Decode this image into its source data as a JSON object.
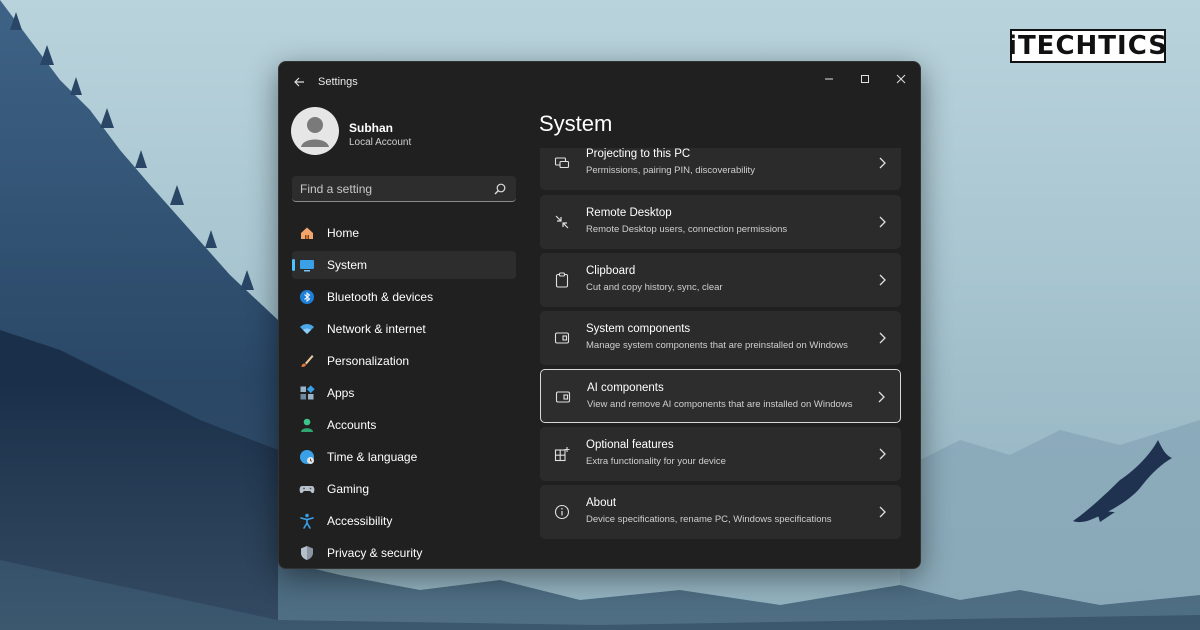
{
  "brand": {
    "logo_text": "iTECHTICS"
  },
  "window": {
    "title": "Settings",
    "controls": [
      "minimize-icon",
      "maximize-icon",
      "close-icon"
    ]
  },
  "user": {
    "name": "Subhan",
    "account_type": "Local Account"
  },
  "search": {
    "placeholder": "Find a setting",
    "value": ""
  },
  "sidebar": {
    "items": [
      {
        "label": "Home",
        "icon": "home-icon",
        "active": false
      },
      {
        "label": "System",
        "icon": "system-icon",
        "active": true
      },
      {
        "label": "Bluetooth & devices",
        "icon": "bluetooth-icon",
        "active": false
      },
      {
        "label": "Network & internet",
        "icon": "wifi-icon",
        "active": false
      },
      {
        "label": "Personalization",
        "icon": "brush-icon",
        "active": false
      },
      {
        "label": "Apps",
        "icon": "apps-icon",
        "active": false
      },
      {
        "label": "Accounts",
        "icon": "accounts-icon",
        "active": false
      },
      {
        "label": "Time & language",
        "icon": "globe-icon",
        "active": false
      },
      {
        "label": "Gaming",
        "icon": "gamepad-icon",
        "active": false
      },
      {
        "label": "Accessibility",
        "icon": "accessibility-icon",
        "active": false
      },
      {
        "label": "Privacy & security",
        "icon": "shield-icon",
        "active": false
      }
    ]
  },
  "main": {
    "title": "System",
    "cards": [
      {
        "title": "Projecting to this PC",
        "desc": "Permissions, pairing PIN, discoverability",
        "icon": "projecting-icon"
      },
      {
        "title": "Remote Desktop",
        "desc": "Remote Desktop users, connection permissions",
        "icon": "remote-desktop-icon"
      },
      {
        "title": "Clipboard",
        "desc": "Cut and copy history, sync, clear",
        "icon": "clipboard-icon"
      },
      {
        "title": "System components",
        "desc": "Manage system components that are preinstalled on Windows",
        "icon": "components-icon"
      },
      {
        "title": "AI components",
        "desc": "View and remove AI components that are installed on Windows",
        "icon": "ai-components-icon",
        "highlighted": true
      },
      {
        "title": "Optional features",
        "desc": "Extra functionality for your device",
        "icon": "optional-features-icon"
      },
      {
        "title": "About",
        "desc": "Device specifications, rename PC, Windows specifications",
        "icon": "info-icon"
      }
    ]
  },
  "colors": {
    "accent": "#4cc2ff",
    "window_bg": "#202020",
    "card_bg": "#2b2b2b"
  }
}
